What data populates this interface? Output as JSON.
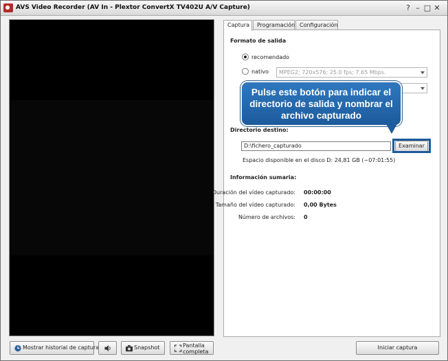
{
  "window": {
    "title": "AVS Video Recorder (AV In - Plextor ConvertX TV402U A/V Capture)",
    "controls": [
      "?",
      "–",
      "□",
      "✕"
    ]
  },
  "tabs": [
    {
      "label": "Captura",
      "active": true
    },
    {
      "label": "Programación",
      "active": false
    },
    {
      "label": "Configuración",
      "active": false
    }
  ],
  "output": {
    "heading": "Formato de salida",
    "recommended_label": "recomendado",
    "native_label": "nativo",
    "native_value": "MPEG2; 720x576; 25.0 fps; 7.65 Mbps.",
    "selected": "recomendado"
  },
  "callout": {
    "text": "Pulse este botón para indicar el directorio de salida y nombrar el archivo capturado"
  },
  "destination": {
    "heading": "Directorio destino:",
    "path": "D:\\fichero_capturado",
    "browse_label": "Examinar",
    "free_space": "Espacio disponible en el disco D: 24,81 GB (~07:01:55)"
  },
  "summary": {
    "heading": "Información sumaria:",
    "rows": [
      {
        "label": "Duración del vídeo capturado:",
        "value": "00:00:00"
      },
      {
        "label": "Tamaño del vídeo capturado:",
        "value": "0,00 Bytes"
      },
      {
        "label": "Número de archivos:",
        "value": "0"
      }
    ]
  },
  "bottom": {
    "history_label": "Mostrar historial de captura",
    "snapshot_label": "Snapshot",
    "fullscreen_line1": "Pantalla",
    "fullscreen_line2": "completa",
    "start_label": "Iniciar captura"
  }
}
